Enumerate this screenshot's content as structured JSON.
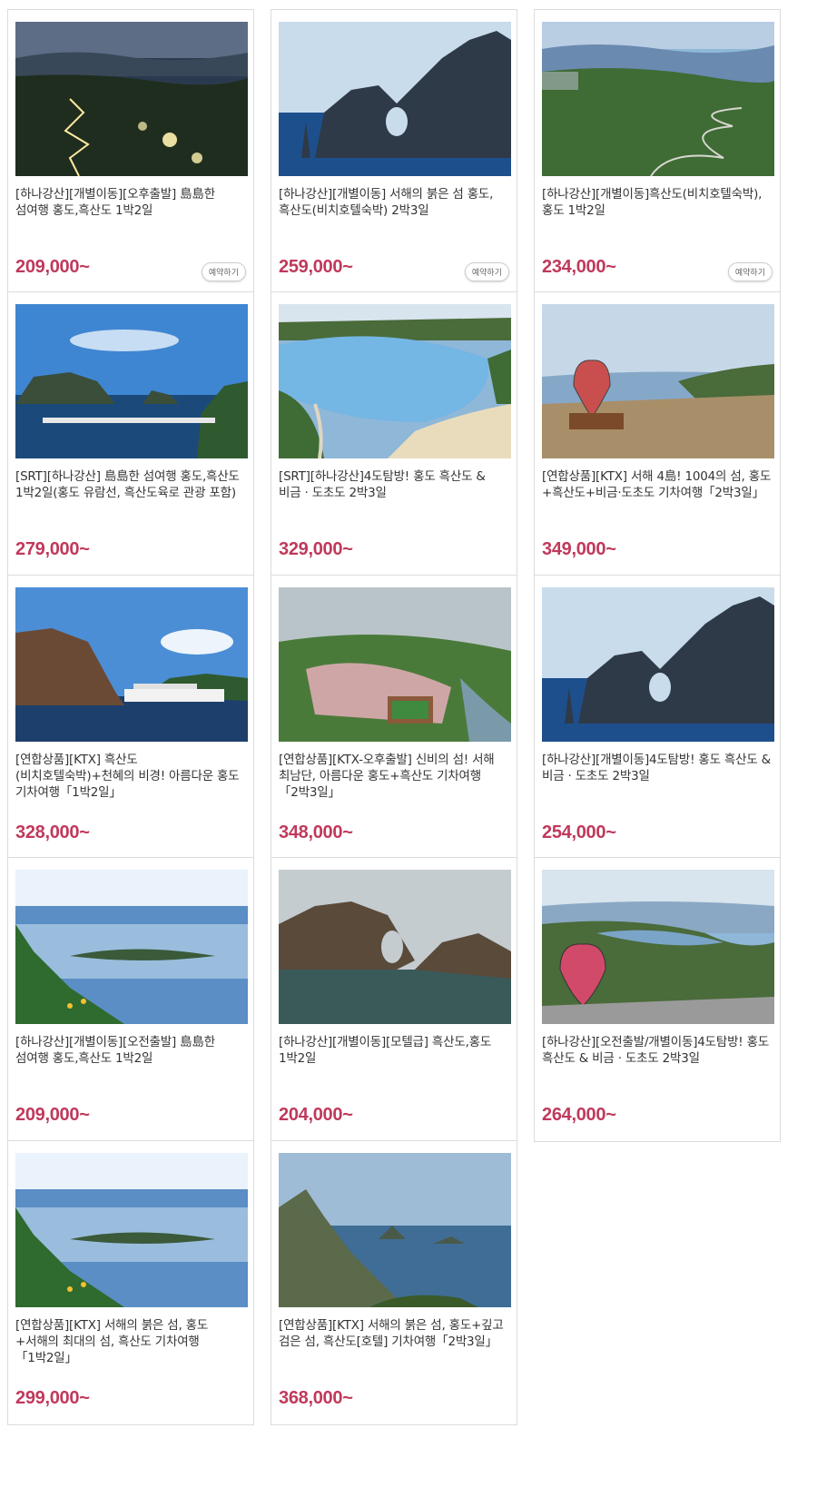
{
  "products": [
    {
      "title": "[하나강산][개별이동][오후출발] 島島한 섬여행 홍도,흑산도 1박2일",
      "price": "209,000~",
      "book_label": "예약하기",
      "image": "night-winding-road-island"
    },
    {
      "title": "[하나강산][개별이동] 서해의 붉은 섬 홍도,흑산도(비치호텔숙박) 2박3일",
      "price": "259,000~",
      "book_label": "예약하기",
      "image": "sea-rock-arch"
    },
    {
      "title": "[하나강산][개별이동]흑산도(비치호텔숙박),홍도 1박2일",
      "price": "234,000~",
      "book_label": "예약하기",
      "image": "coastal-village-winding-road"
    },
    {
      "title": "[SRT][하나강산] 島島한 섬여행 홍도,흑산도 1박2일(홍도 유람선, 흑산도육로 관광 포함)",
      "price": "279,000~",
      "image": "harbor-seawall"
    },
    {
      "title": "[SRT][하나강산]4도탐방! 홍도 흑산도 & 비금 · 도초도 2박3일",
      "price": "329,000~",
      "image": "curved-beach-cove"
    },
    {
      "title": "[연합상품][KTX] 서해 4島! 1004의 섬, 홍도+흑산도+비금·도초도 기차여행「2박3일」",
      "price": "349,000~",
      "image": "heart-sculpture-viewpoint"
    },
    {
      "title": "[연합상품][KTX] 흑산도(비치호텔숙박)+천혜의 비경! 아름다운 홍도 기차여행「1박2일」",
      "price": "328,000~",
      "image": "cliff-with-cruise-ship"
    },
    {
      "title": "[연합상품][KTX-오후출발] 신비의 섬! 서해 최남단, 아름다운 홍도+흑산도 기차여행「2박3일」",
      "price": "348,000~",
      "image": "island-village-aerial"
    },
    {
      "title": "[하나강산][개별이동]4도탐방! 홍도 흑산도 & 비금 · 도초도 2박3일",
      "price": "254,000~",
      "image": "sea-rock-arch"
    },
    {
      "title": "[하나강산][개별이동][오전출발] 島島한 섬여행 홍도,흑산도 1박2일",
      "price": "209,000~",
      "image": "sunlit-sea-islands"
    },
    {
      "title": "[하나강산][개별이동][모텔급] 흑산도,홍도 1박2일",
      "price": "204,000~",
      "image": "rock-arch-gray-sky"
    },
    {
      "title": "[하나강산][오전출발/개별이동]4도탐방! 홍도 흑산도 & 비금 · 도초도 2박3일",
      "price": "264,000~",
      "image": "heart-sculpture-bay"
    },
    {
      "title": "[연합상품][KTX] 서해의 붉은 섬, 홍도+서해의 최대의 섬, 흑산도 기차여행「1박2일」",
      "price": "299,000~",
      "image": "sunlit-sea-islands"
    },
    {
      "title": "[연합상품][KTX] 서해의 붉은 섬, 홍도+깊고 검은 섬, 흑산도[호텔] 기차여행「2박3일」",
      "price": "368,000~",
      "image": "pine-coast-islets"
    }
  ]
}
